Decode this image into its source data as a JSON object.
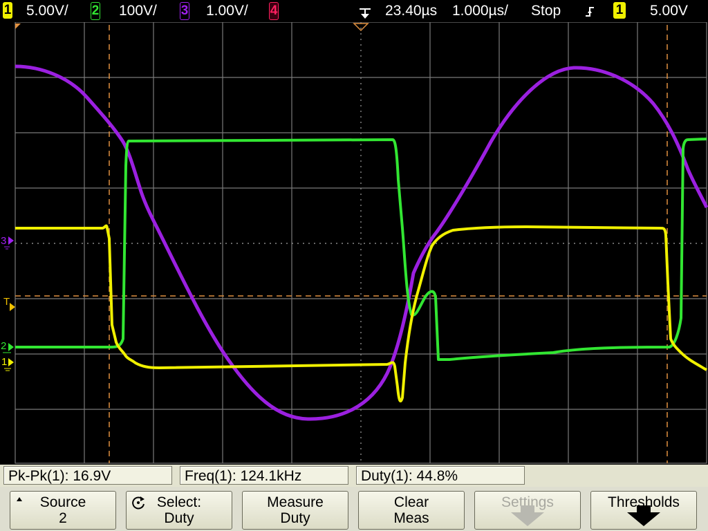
{
  "status_bar": {
    "ch1": {
      "number": "1",
      "scale": "5.00V/",
      "color": "#f0f000"
    },
    "ch2": {
      "number": "2",
      "scale": "100V/",
      "color": "#32e632"
    },
    "ch3": {
      "number": "3",
      "scale": "1.00V/",
      "color": "#a020f0"
    },
    "ch4": {
      "number": "4",
      "color": "#ff2060"
    },
    "time_delay": "23.40µs",
    "time_scale": "1.000µs/",
    "run_state": "Stop",
    "trigger_channel": "1",
    "trigger_level": "5.00V"
  },
  "markers": {
    "ch3": "3",
    "trigger": "T",
    "ch2": "2",
    "ch1": "1"
  },
  "measurements": [
    {
      "label": "Pk-Pk(1): 16.9V"
    },
    {
      "label": "Freq(1): 124.1kHz"
    },
    {
      "label": "Duty(1): 44.8%"
    }
  ],
  "softkeys": {
    "source": {
      "line1": "Source",
      "line2": "2"
    },
    "select": {
      "line1": "Select:",
      "line2": "Duty"
    },
    "measure": {
      "line1": "Measure",
      "line2": "Duty"
    },
    "clear": {
      "line1": "Clear",
      "line2": "Meas"
    },
    "settings": {
      "line1": "Settings"
    },
    "thresholds": {
      "line1": "Thresholds"
    }
  },
  "colors": {
    "grid": "#8a8a8a",
    "cursor": "#e09040"
  }
}
